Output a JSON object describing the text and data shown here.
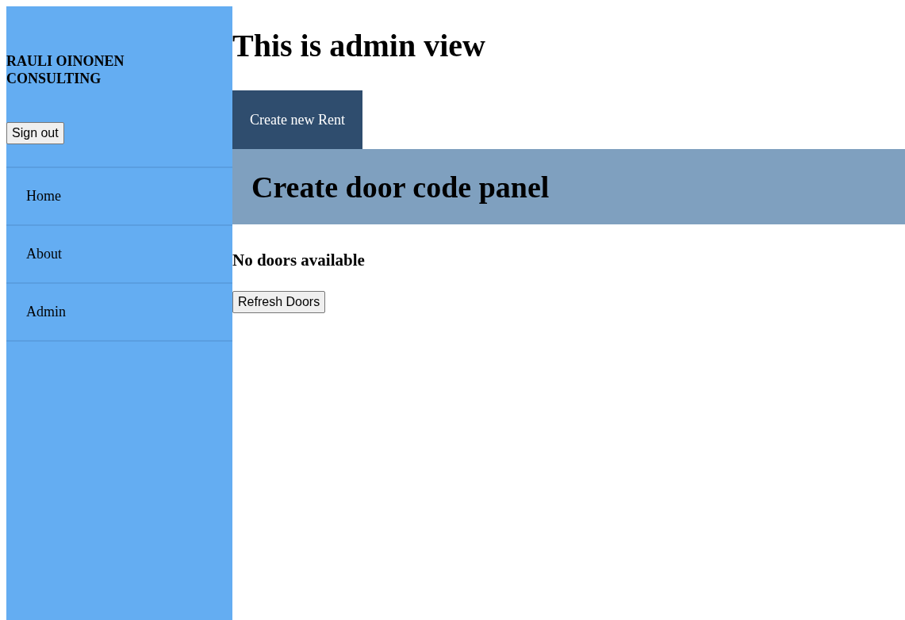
{
  "sidebar": {
    "brand": "RAULI OINONEN CONSULTING",
    "sign_out_button": "Sign out",
    "items": [
      {
        "label": "Home"
      },
      {
        "label": "About"
      },
      {
        "label": "Admin"
      }
    ]
  },
  "heading": "This is admin view",
  "tabs": [
    {
      "label": "Create new Rent"
    }
  ],
  "panel": {
    "title": "Create door code panel",
    "message": "No doors available",
    "button": "Refresh Doors"
  }
}
